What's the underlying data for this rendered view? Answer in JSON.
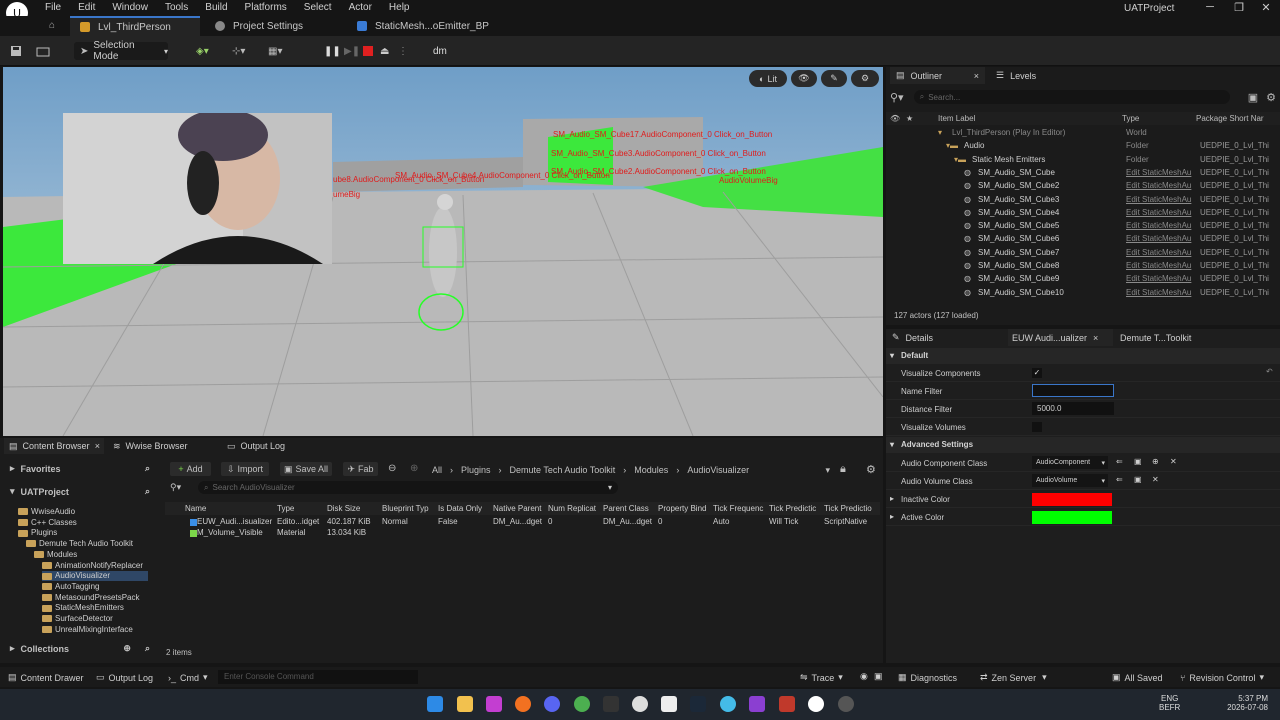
{
  "menu": [
    "File",
    "Edit",
    "Window",
    "Tools",
    "Build",
    "Platforms",
    "Select",
    "Actor",
    "Help"
  ],
  "project_name": "UATProject",
  "tabs": [
    {
      "label": "Lvl_ThirdPerson"
    },
    {
      "label": "Project Settings"
    },
    {
      "label": "StaticMesh...oEmitter_BP"
    }
  ],
  "toolbar": {
    "selection_mode": "Selection Mode",
    "user_initials": "dm"
  },
  "viewport": {
    "lit_label": "Lit",
    "labels_red": [
      "SM_Audio_SM_Cube17.AudioComponent_0 Click_on_Button",
      "SM_Audio_SM_Cube3.AudioComponent_0 Click_on_Button",
      "SM_Audio_SM_Cube2.AudioComponent_0 Click_on_Button",
      "ube8.AudioComponent_0 Click_on_Button",
      "SM_Audio_SM_Cube4.AudioComponent_0 Click_on_Button",
      "AudioVolumeBig",
      "umeBig"
    ]
  },
  "outliner": {
    "tab_outliner": "Outliner",
    "tab_levels": "Levels",
    "search_placeholder": "Search...",
    "col_label": "Item Label",
    "col_type": "Type",
    "col_package": "Package Short Nar",
    "rows": [
      {
        "name": "Lvl_ThirdPerson (Play In Editor)",
        "type": "World",
        "pkg": ""
      },
      {
        "name": "Audio",
        "type": "Folder",
        "pkg": "UEDPIE_0_Lvl_Thi"
      },
      {
        "name": "Static Mesh Emitters",
        "type": "Folder",
        "pkg": "UEDPIE_0_Lvl_Thi"
      },
      {
        "name": "SM_Audio_SM_Cube",
        "type": "Edit StaticMeshAu",
        "pkg": "UEDPIE_0_Lvl_Thi"
      },
      {
        "name": "SM_Audio_SM_Cube2",
        "type": "Edit StaticMeshAu",
        "pkg": "UEDPIE_0_Lvl_Thi"
      },
      {
        "name": "SM_Audio_SM_Cube3",
        "type": "Edit StaticMeshAu",
        "pkg": "UEDPIE_0_Lvl_Thi"
      },
      {
        "name": "SM_Audio_SM_Cube4",
        "type": "Edit StaticMeshAu",
        "pkg": "UEDPIE_0_Lvl_Thi"
      },
      {
        "name": "SM_Audio_SM_Cube5",
        "type": "Edit StaticMeshAu",
        "pkg": "UEDPIE_0_Lvl_Thi"
      },
      {
        "name": "SM_Audio_SM_Cube6",
        "type": "Edit StaticMeshAu",
        "pkg": "UEDPIE_0_Lvl_Thi"
      },
      {
        "name": "SM_Audio_SM_Cube7",
        "type": "Edit StaticMeshAu",
        "pkg": "UEDPIE_0_Lvl_Thi"
      },
      {
        "name": "SM_Audio_SM_Cube8",
        "type": "Edit StaticMeshAu",
        "pkg": "UEDPIE_0_Lvl_Thi"
      },
      {
        "name": "SM_Audio_SM_Cube9",
        "type": "Edit StaticMeshAu",
        "pkg": "UEDPIE_0_Lvl_Thi"
      },
      {
        "name": "SM_Audio_SM_Cube10",
        "type": "Edit StaticMeshAu",
        "pkg": "UEDPIE_0_Lvl_Thi"
      }
    ],
    "actor_count": "127 actors (127 loaded)"
  },
  "details": {
    "tab_details": "Details",
    "tab_euw": "EUW Audi...ualizer",
    "tab_toolkit": "Demute T...Toolkit",
    "section_default": "Default",
    "visualize_components": "Visualize Components",
    "name_filter": "Name Filter",
    "distance_filter": "Distance Filter",
    "distance_value": "5000.0",
    "visualize_volumes": "Visualize Volumes",
    "section_advanced": "Advanced Settings",
    "audio_component_class": "Audio Component Class",
    "audio_component_value": "AudioComponent",
    "audio_volume_class": "Audio Volume Class",
    "audio_volume_value": "AudioVolume",
    "inactive_color": "Inactive Color",
    "active_color": "Active Color",
    "inactive_hex": "#ff0000",
    "active_hex": "#00ff00"
  },
  "content": {
    "tab_cb": "Content Browser",
    "tab_wwise": "Wwise Browser",
    "tab_log": "Output Log",
    "favorites": "Favorites",
    "project": "UATProject",
    "add": "Add",
    "import": "Import",
    "save_all": "Save All",
    "fab": "Fab",
    "path": [
      "All",
      "Plugins",
      "Demute Tech Audio Toolkit",
      "Modules",
      "AudioVisualizer"
    ],
    "search_placeholder": "Search AudioVisualizer",
    "tree": [
      "WwiseAudio",
      "C++ Classes",
      "Plugins",
      "Demute Tech Audio Toolkit",
      "Modules",
      "AnimationNotifyReplacer",
      "AudioVisualizer",
      "AutoTagging",
      "MetasoundPresetsPack",
      "StaticMeshEmitters",
      "SurfaceDetector",
      "UnrealMixingInterface"
    ],
    "columns": [
      "Name",
      "Type",
      "Disk Size",
      "Blueprint Typ",
      "Is Data Only",
      "Native Parent",
      "Num Replicat",
      "Parent Class",
      "Property Bind",
      "Tick Frequenc",
      "Tick Predictic",
      "Tick Predictio"
    ],
    "assets": [
      [
        "EUW_Audi...isualizer",
        "Edito...idget",
        "402.187 KiB",
        "Normal",
        "False",
        "DM_Au...dget",
        "0",
        "DM_Au...dget",
        "0",
        "Auto",
        "Will Tick",
        "ScriptNative"
      ],
      [
        "M_Volume_Visible",
        "Material",
        "13.034 KiB",
        "",
        "",
        "",
        "",
        "",
        "",
        "",
        "",
        ""
      ]
    ],
    "item_count": "2 items",
    "collections": "Collections"
  },
  "status": {
    "content_drawer": "Content Drawer",
    "output_log": "Output Log",
    "cmd": "Cmd",
    "console_placeholder": "Enter Console Command",
    "trace": "Trace",
    "diagnostics": "Diagnostics",
    "zen": "Zen Server",
    "saved": "All Saved",
    "revision": "Revision Control"
  },
  "taskbar": {
    "lang1": "ENG",
    "lang2": "BEFR",
    "time": "5:37 PM",
    "date": "2026-07-08"
  }
}
